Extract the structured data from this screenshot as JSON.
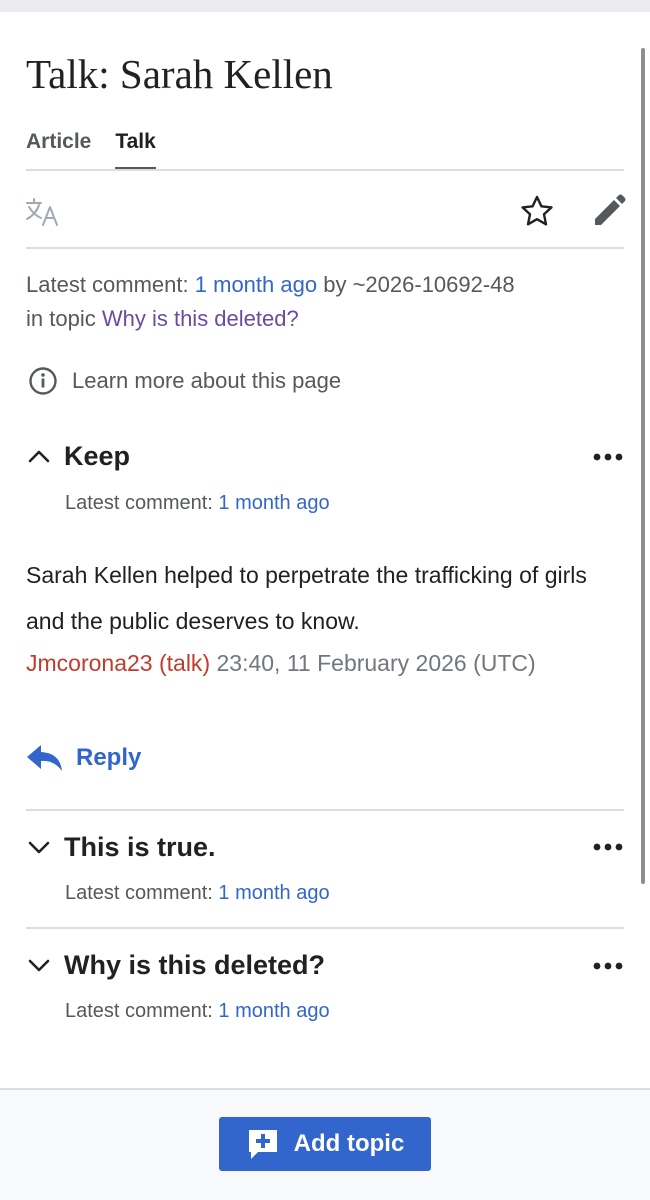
{
  "page": {
    "title": "Talk: Sarah Kellen"
  },
  "tabs": [
    {
      "label": "Article",
      "selected": false
    },
    {
      "label": "Talk",
      "selected": true
    }
  ],
  "toolbar": {
    "icons": [
      "language-icon",
      "star-icon",
      "edit-icon"
    ]
  },
  "summary": {
    "prefix": "Latest comment:",
    "time": "1 month ago",
    "by": "by",
    "user": "~2026-10692-48",
    "in_topic": "in topic",
    "topic": "Why is this deleted?"
  },
  "learn_more": {
    "label": "Learn more about this page"
  },
  "sections": [
    {
      "title": "Keep",
      "expanded": true,
      "meta_prefix": "Latest comment:",
      "meta_time": "1 month ago",
      "comment": {
        "text": "Sarah Kellen helped to perpetrate the trafficking of girls and the public deserves to know.",
        "user": "Jmcorona23",
        "talk_open": "(",
        "talk": "talk",
        "talk_close": ")",
        "timestamp": "23:40, 11 February 2026 (UTC)"
      },
      "reply_label": "Reply"
    },
    {
      "title": "This is true.",
      "expanded": false,
      "meta_prefix": "Latest comment:",
      "meta_time": "1 month ago"
    },
    {
      "title": "Why is this deleted?",
      "expanded": false,
      "meta_prefix": "Latest comment:",
      "meta_time": "1 month ago"
    }
  ],
  "footer": {
    "add_topic_label": "Add topic"
  },
  "colors": {
    "link": "#3366cc",
    "visited_link": "#6b4ba1",
    "red_link": "#bf3c2c",
    "text": "#202122",
    "muted": "#54595d",
    "button": "#3366cc"
  }
}
